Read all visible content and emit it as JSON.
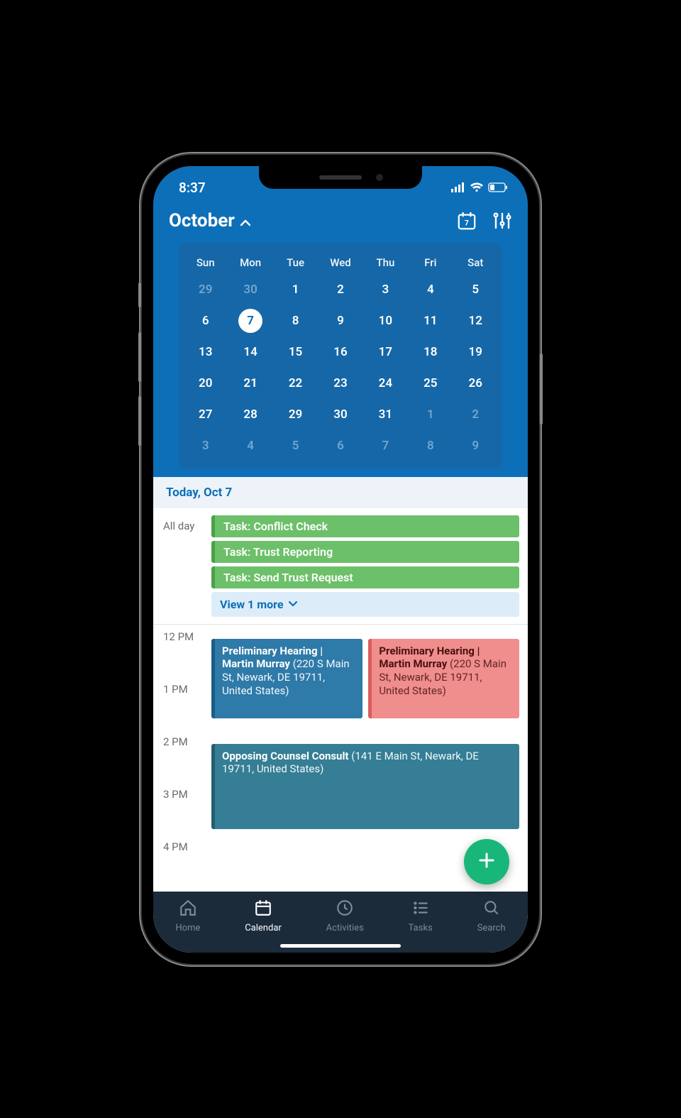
{
  "status": {
    "time": "8:37"
  },
  "header": {
    "month_label": "October",
    "today_icon_day": "7"
  },
  "calendar": {
    "day_headers": [
      "Sun",
      "Mon",
      "Tue",
      "Wed",
      "Thu",
      "Fri",
      "Sat"
    ],
    "weeks": [
      [
        {
          "d": "29",
          "out": true
        },
        {
          "d": "30",
          "out": true
        },
        {
          "d": "1"
        },
        {
          "d": "2"
        },
        {
          "d": "3"
        },
        {
          "d": "4"
        },
        {
          "d": "5"
        }
      ],
      [
        {
          "d": "6"
        },
        {
          "d": "7",
          "selected": true
        },
        {
          "d": "8"
        },
        {
          "d": "9"
        },
        {
          "d": "10"
        },
        {
          "d": "11"
        },
        {
          "d": "12"
        }
      ],
      [
        {
          "d": "13"
        },
        {
          "d": "14"
        },
        {
          "d": "15"
        },
        {
          "d": "16"
        },
        {
          "d": "17"
        },
        {
          "d": "18"
        },
        {
          "d": "19"
        }
      ],
      [
        {
          "d": "20"
        },
        {
          "d": "21"
        },
        {
          "d": "22"
        },
        {
          "d": "23"
        },
        {
          "d": "24"
        },
        {
          "d": "25"
        },
        {
          "d": "26"
        }
      ],
      [
        {
          "d": "27"
        },
        {
          "d": "28"
        },
        {
          "d": "29"
        },
        {
          "d": "30"
        },
        {
          "d": "31"
        },
        {
          "d": "1",
          "out": true
        },
        {
          "d": "2",
          "out": true
        }
      ],
      [
        {
          "d": "3",
          "out": true
        },
        {
          "d": "4",
          "out": true
        },
        {
          "d": "5",
          "out": true
        },
        {
          "d": "6",
          "out": true
        },
        {
          "d": "7",
          "out": true
        },
        {
          "d": "8",
          "out": true
        },
        {
          "d": "9",
          "out": true
        }
      ]
    ]
  },
  "agenda": {
    "today_label": "Today, Oct 7",
    "all_day_label": "All day",
    "tasks": [
      "Task: Conflict Check",
      "Task: Trust Reporting",
      "Task: Send Trust Request"
    ],
    "view_more": "View 1 more",
    "time_labels": [
      "12 PM",
      "1 PM",
      "2 PM",
      "3 PM",
      "4 PM"
    ],
    "events": [
      {
        "title": "Preliminary Hearing | Martin Murray",
        "loc": "(220 S Main St, Newark, DE 19711, United States)",
        "color": "blue"
      },
      {
        "title": "Preliminary Hearing | Martin Murray",
        "loc": "(220 S Main St, Newark, DE 19711, United States)",
        "color": "red"
      },
      {
        "title": "Opposing Counsel Consult",
        "loc": "(141 E Main St, Newark, DE 19711, United States)",
        "color": "teal"
      }
    ]
  },
  "tabs": [
    {
      "label": "Home"
    },
    {
      "label": "Calendar"
    },
    {
      "label": "Activities"
    },
    {
      "label": "Tasks"
    },
    {
      "label": "Search"
    }
  ]
}
